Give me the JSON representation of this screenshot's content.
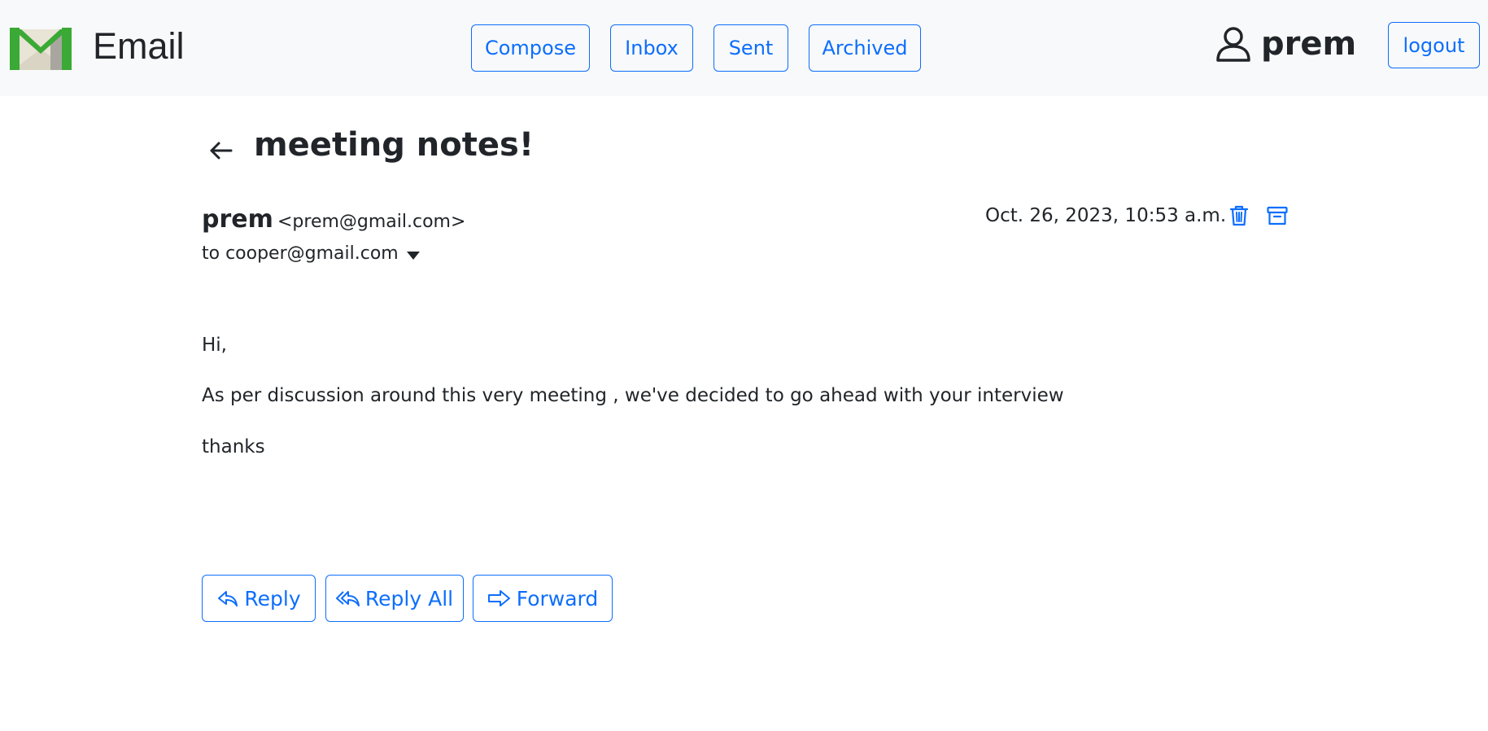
{
  "navbar": {
    "logo_icon": "gmail-m-envelope-icon",
    "brand": "Email",
    "nav_items": [
      "Compose",
      "Inbox",
      "Sent",
      "Archived"
    ],
    "user_icon": "person-icon",
    "username": "prem",
    "logout_label": "logout"
  },
  "email": {
    "back_icon": "arrow-left-icon",
    "subject": "meeting notes!",
    "sender_name": "prem",
    "sender_email": "<prem@gmail.com>",
    "recipient": "to cooper@gmail.com",
    "timestamp": "Oct. 26, 2023, 10:53 a.m.",
    "delete_icon": "trash-icon",
    "archive_icon": "archive-box-icon",
    "body": [
      "Hi,",
      "As per discussion around this very meeting , we've decided to go ahead with your interview",
      "thanks"
    ]
  },
  "actions": {
    "reply": "Reply",
    "reply_all": "Reply All",
    "forward": "Forward"
  },
  "colors": {
    "accent": "#0d6efd",
    "navbar_bg": "#f8f9fa",
    "text": "#212529",
    "logo_green": "#3aa935"
  }
}
